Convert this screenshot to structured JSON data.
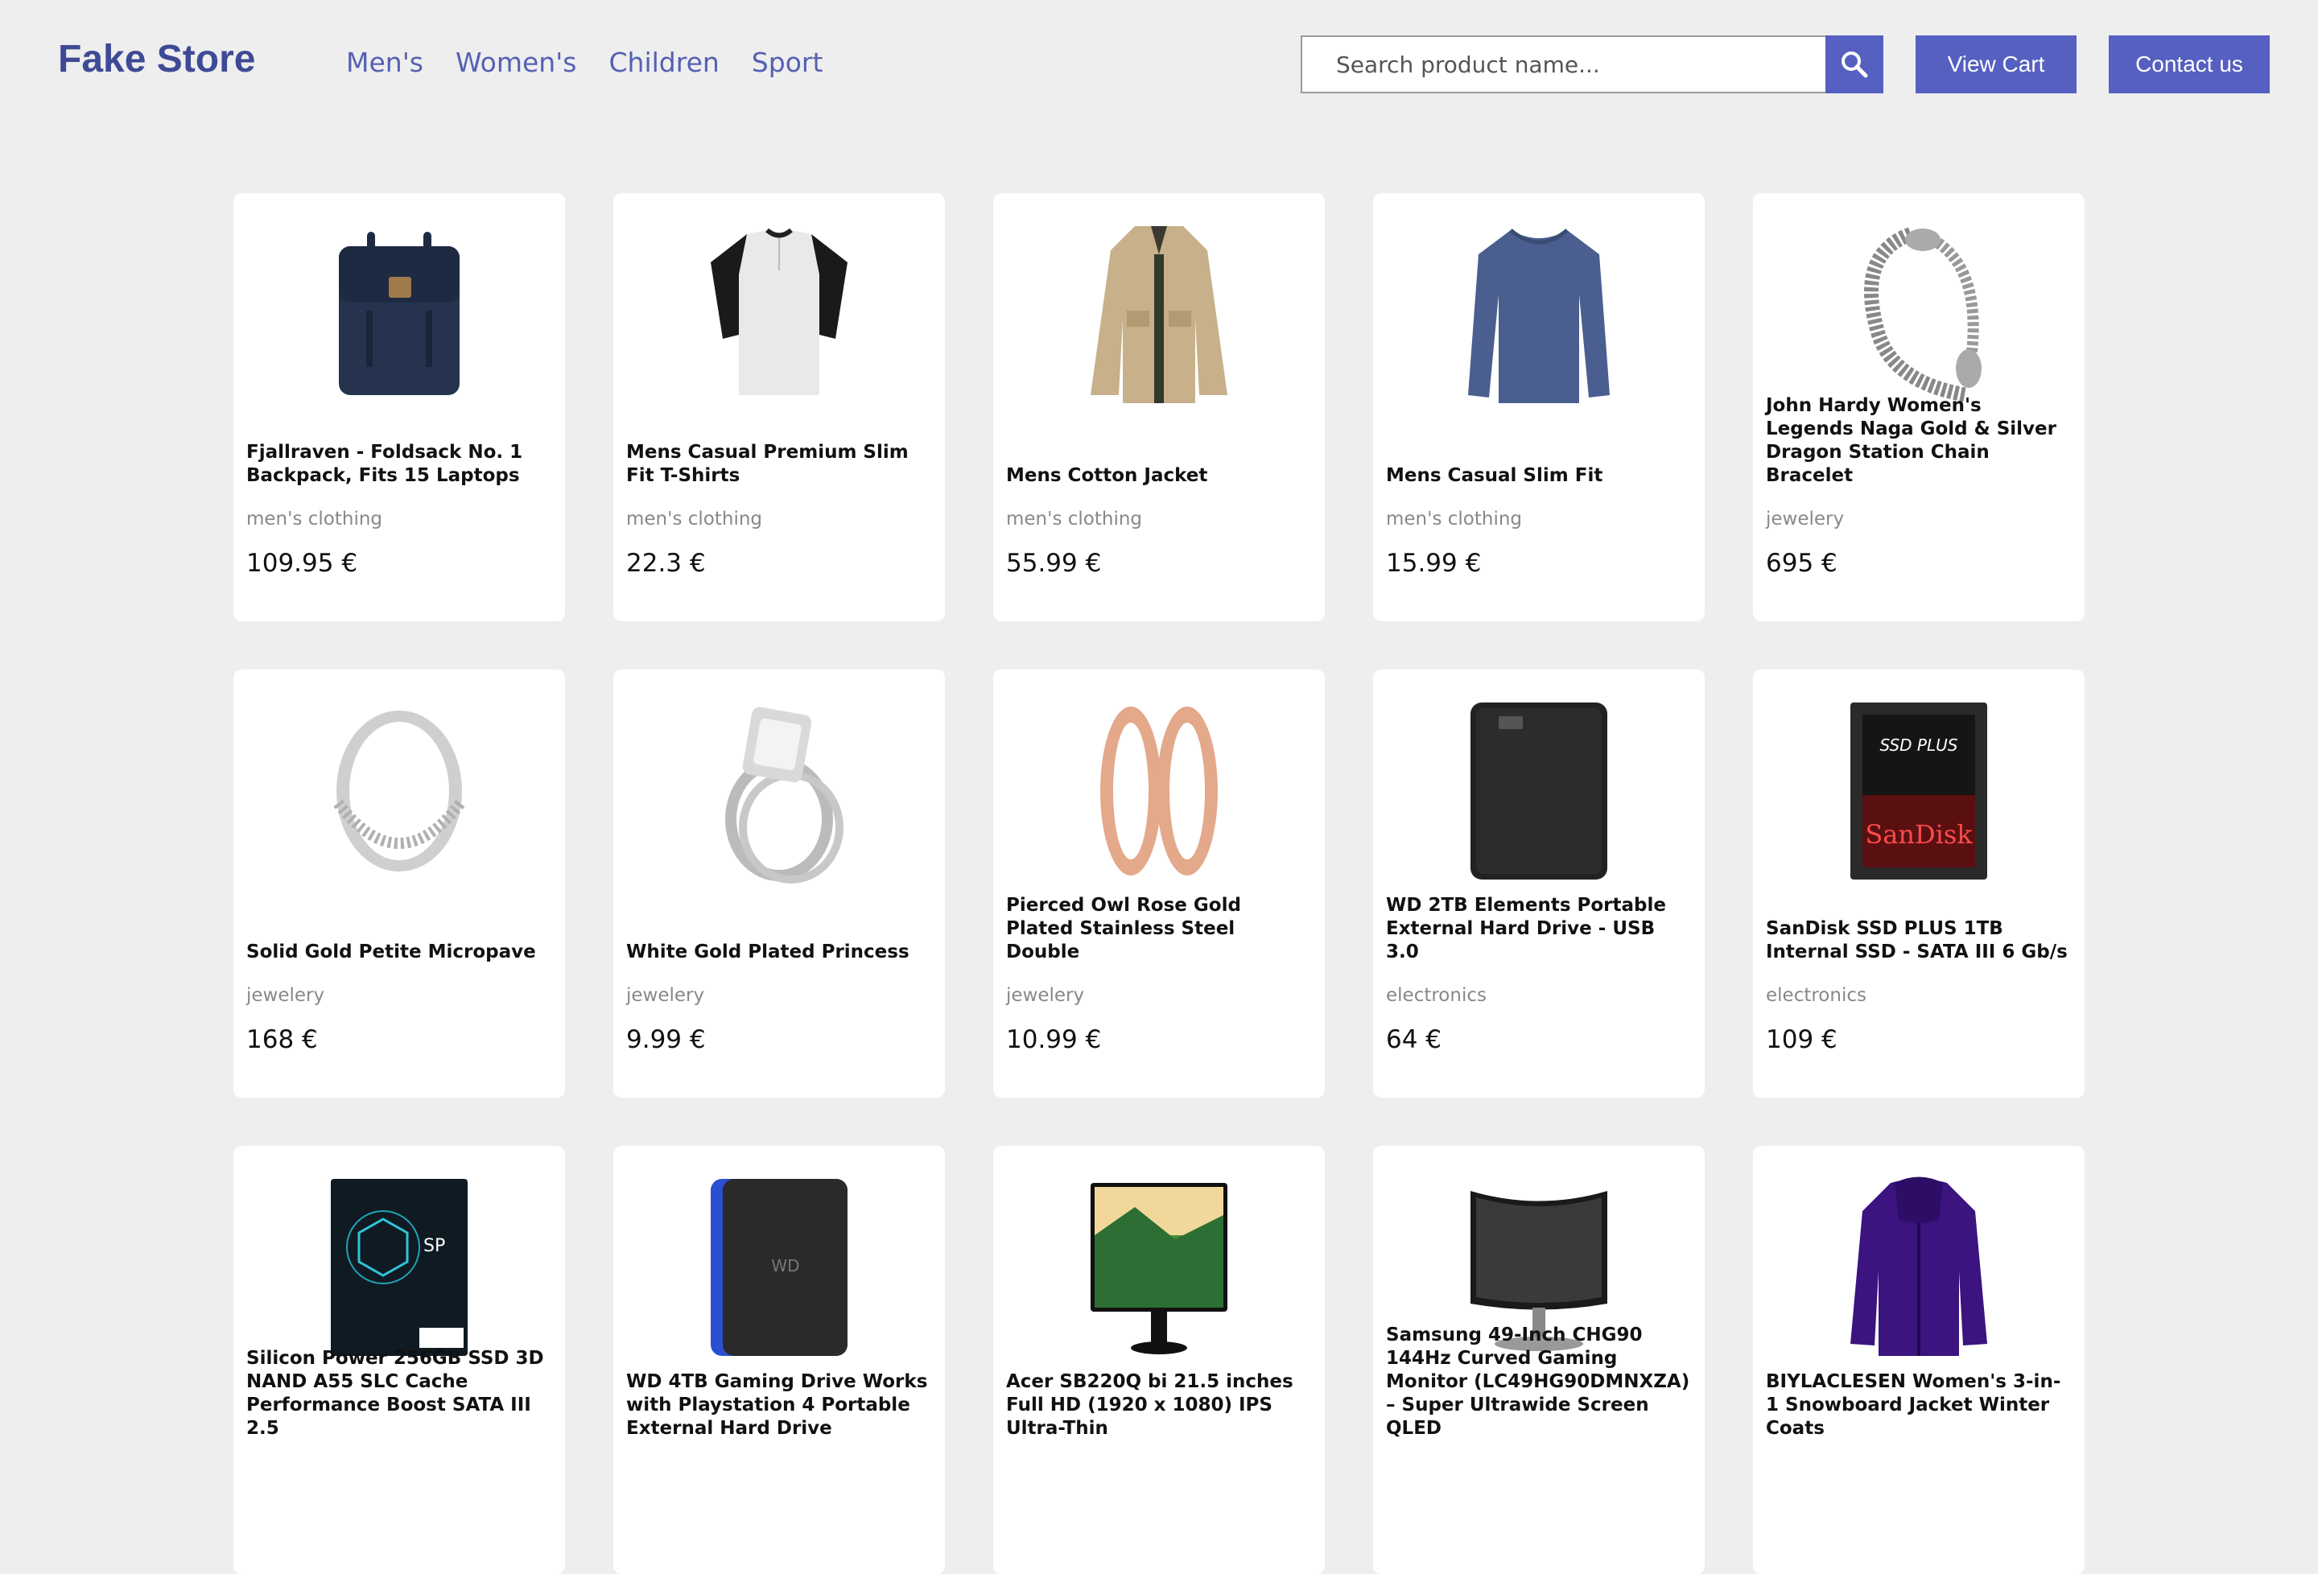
{
  "header": {
    "logo": "Fake Store",
    "nav": [
      "Men's",
      "Women's",
      "Children",
      "Sport"
    ],
    "search_placeholder": "Search product name...",
    "view_cart_label": "View Cart",
    "contact_label": "Contact us"
  },
  "colors": {
    "accent": "#5560c0",
    "logo": "#3f4a96",
    "background": "#eeeeee"
  },
  "products": [
    {
      "title": "Fjallraven - Foldsack No. 1 Backpack, Fits 15 Laptops",
      "category": "men's clothing",
      "price": "109.95 €",
      "image": "backpack"
    },
    {
      "title": "Mens Casual Premium Slim Fit T-Shirts",
      "category": "men's clothing",
      "price": "22.3 €",
      "image": "tshirt"
    },
    {
      "title": "Mens Cotton Jacket",
      "category": "men's clothing",
      "price": "55.99 €",
      "image": "jacket"
    },
    {
      "title": "Mens Casual Slim Fit",
      "category": "men's clothing",
      "price": "15.99 €",
      "image": "longsleeve"
    },
    {
      "title": "John Hardy Women's Legends Naga Gold & Silver Dragon Station Chain Bracelet",
      "category": "jewelery",
      "price": "695 €",
      "image": "bracelet"
    },
    {
      "title": "Solid Gold Petite Micropave",
      "category": "jewelery",
      "price": "168 €",
      "image": "ring"
    },
    {
      "title": "White Gold Plated Princess",
      "category": "jewelery",
      "price": "9.99 €",
      "image": "diamond-ring"
    },
    {
      "title": "Pierced Owl Rose Gold Plated Stainless Steel Double",
      "category": "jewelery",
      "price": "10.99 €",
      "image": "plugs"
    },
    {
      "title": "WD 2TB Elements Portable External Hard Drive - USB 3.0",
      "category": "electronics",
      "price": "64 €",
      "image": "hdd"
    },
    {
      "title": "SanDisk SSD PLUS 1TB Internal SSD - SATA III 6 Gb/s",
      "category": "electronics",
      "price": "109 €",
      "image": "ssd"
    },
    {
      "title": "Silicon Power 256GB SSD 3D NAND A55 SLC Cache Performance Boost SATA III 2.5",
      "category": "",
      "price": "",
      "image": "ssd-sp"
    },
    {
      "title": "WD 4TB Gaming Drive Works with Playstation 4 Portable External Hard Drive",
      "category": "",
      "price": "",
      "image": "gaming-drive"
    },
    {
      "title": "Acer SB220Q bi 21.5 inches Full HD (1920 x 1080) IPS Ultra-Thin",
      "category": "",
      "price": "",
      "image": "monitor"
    },
    {
      "title": "Samsung 49-Inch CHG90 144Hz Curved Gaming Monitor (LC49HG90DMNXZA) – Super Ultrawide Screen QLED",
      "category": "",
      "price": "",
      "image": "curved-monitor"
    },
    {
      "title": "BIYLACLESEN Women's 3-in-1 Snowboard Jacket Winter Coats",
      "category": "",
      "price": "",
      "image": "purple-jacket"
    }
  ]
}
